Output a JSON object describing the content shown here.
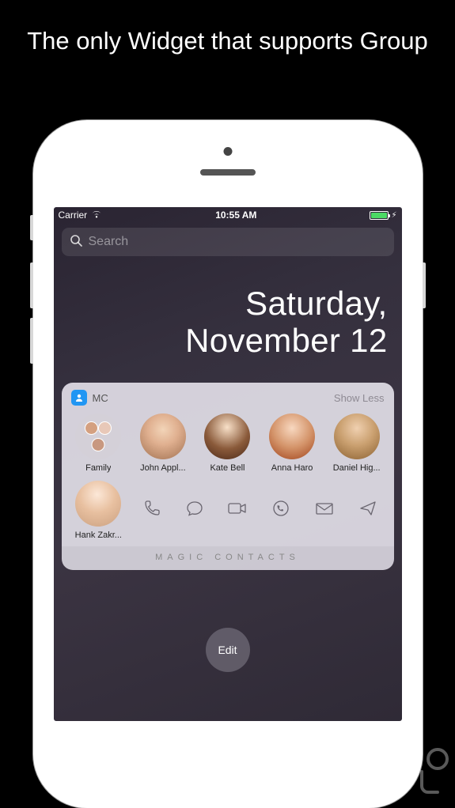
{
  "promo": {
    "headline": "The only Widget that supports Group"
  },
  "status_bar": {
    "carrier": "Carrier",
    "time": "10:55 AM",
    "charging_indicator": "⚡︎"
  },
  "search": {
    "placeholder": "Search"
  },
  "date": {
    "weekday": "Saturday,",
    "month_day": "November 12"
  },
  "widget": {
    "app_name": "MC",
    "collapse_label": "Show Less",
    "footer": "MAGIC CONTACTS",
    "contacts": [
      {
        "name": "Family",
        "is_group": true
      },
      {
        "name": "John Appl..."
      },
      {
        "name": "Kate Bell"
      },
      {
        "name": "Anna Haro"
      },
      {
        "name": "Daniel Hig..."
      },
      {
        "name": "Hank Zakr..."
      }
    ],
    "actions": [
      "call",
      "message",
      "video",
      "whatsapp",
      "email",
      "telegram"
    ]
  },
  "edit_button": {
    "label": "Edit"
  }
}
